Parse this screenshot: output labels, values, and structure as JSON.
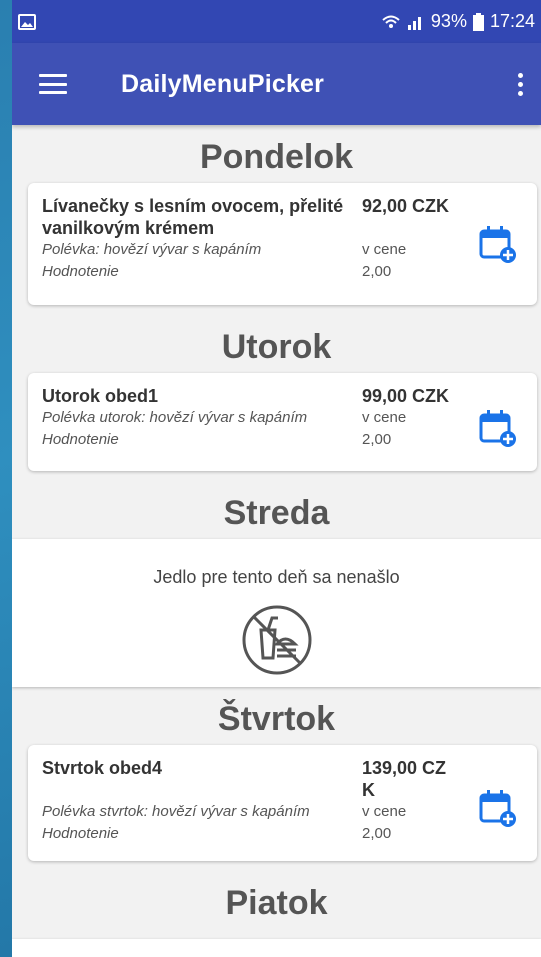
{
  "statusbar": {
    "gallery_icon": "image-icon",
    "battery": "93%",
    "time": "17:24"
  },
  "appbar": {
    "title": "DailyMenuPicker",
    "menu_icon": "hamburger-icon",
    "overflow_icon": "more-vert-icon"
  },
  "days": [
    {
      "title": "Pondelok",
      "meal": {
        "name": "Lívanečky s lesním ovocem, přelité vanilkovým krémem",
        "price": "92,00 CZK",
        "soup": "Polévka: hovězí vývar s kapáním",
        "soup_price": "v cene",
        "rating_label": "Hodnotenie",
        "rating": "2,00"
      }
    },
    {
      "title": "Utorok",
      "meal": {
        "name": "Utorok obed1",
        "price": "99,00 CZK",
        "soup": "Polévka utorok: hovězí vývar s kapáním",
        "soup_price": "v cene",
        "rating_label": "Hodnotenie",
        "rating": "2,00"
      }
    },
    {
      "title": "Streda",
      "empty_text": "Jedlo pre tento deň sa nenašlo"
    },
    {
      "title": "Štvrtok",
      "meal": {
        "name": "Stvrtok obed4",
        "price_line1": "139,00 CZ",
        "price_line2": "K",
        "soup": "Polévka stvrtok: hovězí vývar s kapáním",
        "soup_price": "v cene",
        "rating_label": "Hodnotenie",
        "rating": "2,00"
      }
    },
    {
      "title": "Piatok"
    }
  ],
  "colors": {
    "appbar": "#3f51b5",
    "statusbar": "#3247b3",
    "calendar_icon": "#1a73e8"
  }
}
